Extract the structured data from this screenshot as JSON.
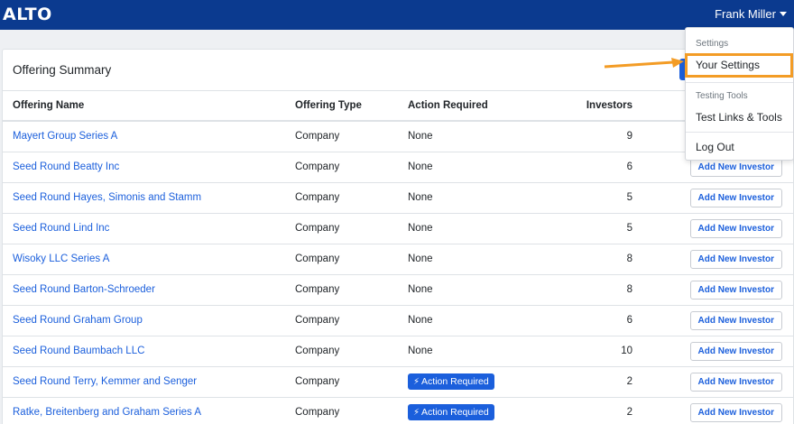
{
  "navbar": {
    "logo": "ALTO",
    "user_name": "Frank Miller"
  },
  "card": {
    "title": "Offering Summary"
  },
  "table": {
    "headers": {
      "name": "Offering Name",
      "type": "Offering Type",
      "action": "Action Required",
      "investors": "Investors"
    },
    "button_label": "Add New Investor",
    "badge_label": "Action Required",
    "rows": [
      {
        "name": "Mayert Group Series A",
        "type": "Company",
        "action": "None",
        "investors": "9"
      },
      {
        "name": "Seed Round Beatty Inc",
        "type": "Company",
        "action": "None",
        "investors": "6"
      },
      {
        "name": "Seed Round Hayes, Simonis and Stamm",
        "type": "Company",
        "action": "None",
        "investors": "5"
      },
      {
        "name": "Seed Round Lind Inc",
        "type": "Company",
        "action": "None",
        "investors": "5"
      },
      {
        "name": "Wisoky LLC Series A",
        "type": "Company",
        "action": "None",
        "investors": "8"
      },
      {
        "name": "Seed Round Barton-Schroeder",
        "type": "Company",
        "action": "None",
        "investors": "8"
      },
      {
        "name": "Seed Round Graham Group",
        "type": "Company",
        "action": "None",
        "investors": "6"
      },
      {
        "name": "Seed Round Baumbach LLC",
        "type": "Company",
        "action": "None",
        "investors": "10"
      },
      {
        "name": "Seed Round Terry, Kemmer and Senger",
        "type": "Company",
        "action": "Action Required",
        "investors": "2"
      },
      {
        "name": "Ratke, Breitenberg and Graham Series A",
        "type": "Company",
        "action": "Action Required",
        "investors": "2"
      }
    ]
  },
  "dropdown": {
    "settings_header": "Settings",
    "your_settings": "Your Settings",
    "testing_header": "Testing Tools",
    "test_links": "Test Links & Tools",
    "log_out": "Log Out"
  },
  "colors": {
    "navbar": "#0b3a8f",
    "accent": "#1b5fdc",
    "highlight": "#f39c26"
  },
  "icons": {
    "badge_icon": "bolt-icon",
    "menu_caret": "caret-down-icon",
    "annotation": "arrow-right-icon"
  }
}
